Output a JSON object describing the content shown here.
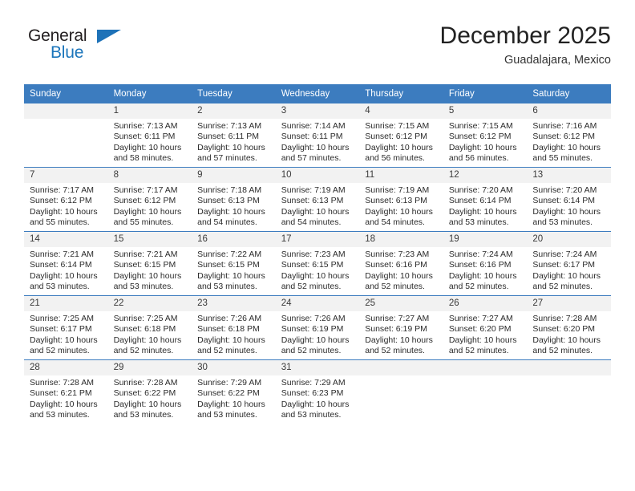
{
  "brand": {
    "name_top": "General",
    "name_bottom": "Blue",
    "flag_icon": "triangle-flag-icon",
    "color_dark": "#231f20",
    "color_blue": "#1b75bb"
  },
  "header": {
    "title": "December 2025",
    "subtitle": "Guadalajara, Mexico"
  },
  "theme": {
    "header_blue": "#3c7cbf",
    "daynum_gray": "#f2f2f2",
    "text": "#2b2b2b"
  },
  "calendar": {
    "weekday_headers": [
      "Sunday",
      "Monday",
      "Tuesday",
      "Wednesday",
      "Thursday",
      "Friday",
      "Saturday"
    ],
    "labels": {
      "sunrise_prefix": "Sunrise:",
      "sunset_prefix": "Sunset:",
      "daylight_prefix": "Daylight:"
    },
    "weeks": [
      [
        {
          "day": "",
          "empty": true,
          "lines": []
        },
        {
          "day": "1",
          "empty": false,
          "lines": [
            "Sunrise: 7:13 AM",
            "Sunset: 6:11 PM",
            "Daylight: 10 hours",
            "and 58 minutes."
          ]
        },
        {
          "day": "2",
          "empty": false,
          "lines": [
            "Sunrise: 7:13 AM",
            "Sunset: 6:11 PM",
            "Daylight: 10 hours",
            "and 57 minutes."
          ]
        },
        {
          "day": "3",
          "empty": false,
          "lines": [
            "Sunrise: 7:14 AM",
            "Sunset: 6:11 PM",
            "Daylight: 10 hours",
            "and 57 minutes."
          ]
        },
        {
          "day": "4",
          "empty": false,
          "lines": [
            "Sunrise: 7:15 AM",
            "Sunset: 6:12 PM",
            "Daylight: 10 hours",
            "and 56 minutes."
          ]
        },
        {
          "day": "5",
          "empty": false,
          "lines": [
            "Sunrise: 7:15 AM",
            "Sunset: 6:12 PM",
            "Daylight: 10 hours",
            "and 56 minutes."
          ]
        },
        {
          "day": "6",
          "empty": false,
          "lines": [
            "Sunrise: 7:16 AM",
            "Sunset: 6:12 PM",
            "Daylight: 10 hours",
            "and 55 minutes."
          ]
        }
      ],
      [
        {
          "day": "7",
          "empty": false,
          "lines": [
            "Sunrise: 7:17 AM",
            "Sunset: 6:12 PM",
            "Daylight: 10 hours",
            "and 55 minutes."
          ]
        },
        {
          "day": "8",
          "empty": false,
          "lines": [
            "Sunrise: 7:17 AM",
            "Sunset: 6:12 PM",
            "Daylight: 10 hours",
            "and 55 minutes."
          ]
        },
        {
          "day": "9",
          "empty": false,
          "lines": [
            "Sunrise: 7:18 AM",
            "Sunset: 6:13 PM",
            "Daylight: 10 hours",
            "and 54 minutes."
          ]
        },
        {
          "day": "10",
          "empty": false,
          "lines": [
            "Sunrise: 7:19 AM",
            "Sunset: 6:13 PM",
            "Daylight: 10 hours",
            "and 54 minutes."
          ]
        },
        {
          "day": "11",
          "empty": false,
          "lines": [
            "Sunrise: 7:19 AM",
            "Sunset: 6:13 PM",
            "Daylight: 10 hours",
            "and 54 minutes."
          ]
        },
        {
          "day": "12",
          "empty": false,
          "lines": [
            "Sunrise: 7:20 AM",
            "Sunset: 6:14 PM",
            "Daylight: 10 hours",
            "and 53 minutes."
          ]
        },
        {
          "day": "13",
          "empty": false,
          "lines": [
            "Sunrise: 7:20 AM",
            "Sunset: 6:14 PM",
            "Daylight: 10 hours",
            "and 53 minutes."
          ]
        }
      ],
      [
        {
          "day": "14",
          "empty": false,
          "lines": [
            "Sunrise: 7:21 AM",
            "Sunset: 6:14 PM",
            "Daylight: 10 hours",
            "and 53 minutes."
          ]
        },
        {
          "day": "15",
          "empty": false,
          "lines": [
            "Sunrise: 7:21 AM",
            "Sunset: 6:15 PM",
            "Daylight: 10 hours",
            "and 53 minutes."
          ]
        },
        {
          "day": "16",
          "empty": false,
          "lines": [
            "Sunrise: 7:22 AM",
            "Sunset: 6:15 PM",
            "Daylight: 10 hours",
            "and 53 minutes."
          ]
        },
        {
          "day": "17",
          "empty": false,
          "lines": [
            "Sunrise: 7:23 AM",
            "Sunset: 6:15 PM",
            "Daylight: 10 hours",
            "and 52 minutes."
          ]
        },
        {
          "day": "18",
          "empty": false,
          "lines": [
            "Sunrise: 7:23 AM",
            "Sunset: 6:16 PM",
            "Daylight: 10 hours",
            "and 52 minutes."
          ]
        },
        {
          "day": "19",
          "empty": false,
          "lines": [
            "Sunrise: 7:24 AM",
            "Sunset: 6:16 PM",
            "Daylight: 10 hours",
            "and 52 minutes."
          ]
        },
        {
          "day": "20",
          "empty": false,
          "lines": [
            "Sunrise: 7:24 AM",
            "Sunset: 6:17 PM",
            "Daylight: 10 hours",
            "and 52 minutes."
          ]
        }
      ],
      [
        {
          "day": "21",
          "empty": false,
          "lines": [
            "Sunrise: 7:25 AM",
            "Sunset: 6:17 PM",
            "Daylight: 10 hours",
            "and 52 minutes."
          ]
        },
        {
          "day": "22",
          "empty": false,
          "lines": [
            "Sunrise: 7:25 AM",
            "Sunset: 6:18 PM",
            "Daylight: 10 hours",
            "and 52 minutes."
          ]
        },
        {
          "day": "23",
          "empty": false,
          "lines": [
            "Sunrise: 7:26 AM",
            "Sunset: 6:18 PM",
            "Daylight: 10 hours",
            "and 52 minutes."
          ]
        },
        {
          "day": "24",
          "empty": false,
          "lines": [
            "Sunrise: 7:26 AM",
            "Sunset: 6:19 PM",
            "Daylight: 10 hours",
            "and 52 minutes."
          ]
        },
        {
          "day": "25",
          "empty": false,
          "lines": [
            "Sunrise: 7:27 AM",
            "Sunset: 6:19 PM",
            "Daylight: 10 hours",
            "and 52 minutes."
          ]
        },
        {
          "day": "26",
          "empty": false,
          "lines": [
            "Sunrise: 7:27 AM",
            "Sunset: 6:20 PM",
            "Daylight: 10 hours",
            "and 52 minutes."
          ]
        },
        {
          "day": "27",
          "empty": false,
          "lines": [
            "Sunrise: 7:28 AM",
            "Sunset: 6:20 PM",
            "Daylight: 10 hours",
            "and 52 minutes."
          ]
        }
      ],
      [
        {
          "day": "28",
          "empty": false,
          "lines": [
            "Sunrise: 7:28 AM",
            "Sunset: 6:21 PM",
            "Daylight: 10 hours",
            "and 53 minutes."
          ]
        },
        {
          "day": "29",
          "empty": false,
          "lines": [
            "Sunrise: 7:28 AM",
            "Sunset: 6:22 PM",
            "Daylight: 10 hours",
            "and 53 minutes."
          ]
        },
        {
          "day": "30",
          "empty": false,
          "lines": [
            "Sunrise: 7:29 AM",
            "Sunset: 6:22 PM",
            "Daylight: 10 hours",
            "and 53 minutes."
          ]
        },
        {
          "day": "31",
          "empty": false,
          "lines": [
            "Sunrise: 7:29 AM",
            "Sunset: 6:23 PM",
            "Daylight: 10 hours",
            "and 53 minutes."
          ]
        },
        {
          "day": "",
          "empty": true,
          "lines": []
        },
        {
          "day": "",
          "empty": true,
          "lines": []
        },
        {
          "day": "",
          "empty": true,
          "lines": []
        }
      ]
    ]
  }
}
